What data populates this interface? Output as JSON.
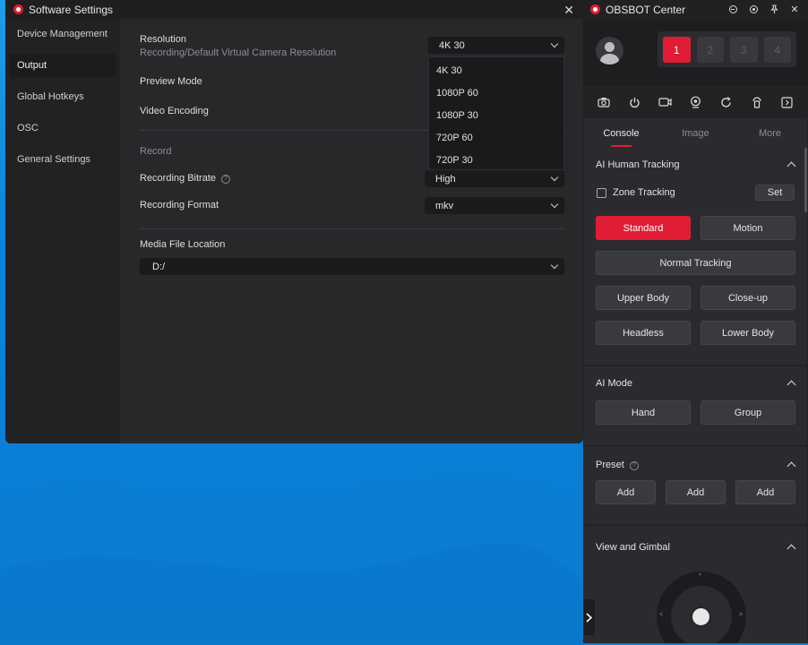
{
  "settings_window": {
    "title": "Software Settings",
    "sidebar": [
      {
        "label": "Device Management",
        "active": false
      },
      {
        "label": "Output",
        "active": true
      },
      {
        "label": "Global Hotkeys",
        "active": false
      },
      {
        "label": "OSC",
        "active": false
      },
      {
        "label": "General Settings",
        "active": false
      }
    ],
    "resolution": {
      "label": "Resolution",
      "sublabel": "Recording/Default Virtual Camera Resolution",
      "value": "4K 30",
      "options": [
        "4K 30",
        "1080P 60",
        "1080P 30",
        "720P 60",
        "720P 30"
      ]
    },
    "preview_mode_label": "Preview Mode",
    "video_encoding_label": "Video Encoding",
    "record_section": "Record",
    "recording_bitrate": {
      "label": "Recording Bitrate",
      "value": "High"
    },
    "recording_format": {
      "label": "Recording Format",
      "value": "mkv"
    },
    "media_location": {
      "label": "Media File Location",
      "value": "D:/"
    }
  },
  "obsbot_window": {
    "title": "OBSBOT Center",
    "devices": [
      "1",
      "2",
      "3",
      "4"
    ],
    "active_device": "1",
    "toolbar_icons": [
      "camera-icon",
      "power-icon",
      "video-record-icon",
      "webcam-icon",
      "refresh-icon",
      "gimbal-icon",
      "collapse-panel-icon"
    ],
    "tabs": [
      {
        "label": "Console",
        "active": true
      },
      {
        "label": "Image",
        "active": false
      },
      {
        "label": "More",
        "active": false
      }
    ],
    "ai_tracking": {
      "title": "AI Human Tracking",
      "zone_tracking_label": "Zone Tracking",
      "zone_tracking_checked": false,
      "set_label": "Set",
      "standard_label": "Standard",
      "motion_label": "Motion",
      "normal_tracking_label": "Normal Tracking",
      "upper_body_label": "Upper Body",
      "close_up_label": "Close-up",
      "headless_label": "Headless",
      "lower_body_label": "Lower Body"
    },
    "ai_mode": {
      "title": "AI Mode",
      "hand_label": "Hand",
      "group_label": "Group"
    },
    "preset": {
      "title": "Preset",
      "add_labels": [
        "Add",
        "Add",
        "Add"
      ]
    },
    "view_gimbal": {
      "title": "View and Gimbal"
    }
  },
  "colors": {
    "accent": "#e11d35",
    "desktop": "#0b86dc"
  }
}
